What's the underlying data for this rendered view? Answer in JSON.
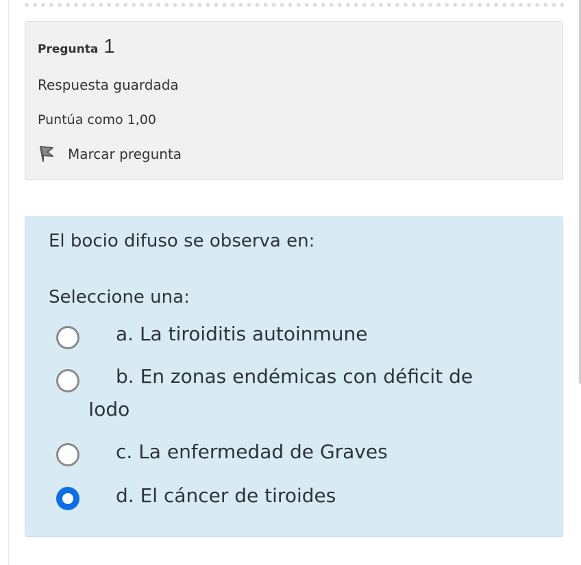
{
  "question_info": {
    "label": "Pregunta",
    "number": "1",
    "state": "Respuesta guardada",
    "grade": "Puntúa como 1,00",
    "flag_label": "Marcar pregunta",
    "flag_icon": "flag-icon"
  },
  "question": {
    "text": "El bocio difuso se observa en:",
    "prompt": "Seleccione una:",
    "options": [
      {
        "label": "a. La tiroiditis autoinmune",
        "selected": false
      },
      {
        "label_line1": "b. En zonas endémicas con déficit de",
        "label_line2": "Iodo",
        "selected": false
      },
      {
        "label": "c. La enfermedad de Graves",
        "selected": false
      },
      {
        "label": "d. El cáncer de tiroides",
        "selected": true
      }
    ]
  },
  "colors": {
    "info_background": "#f1f1f1",
    "question_background": "#d8ebf4",
    "radio_selected": "#0b6fe5"
  }
}
